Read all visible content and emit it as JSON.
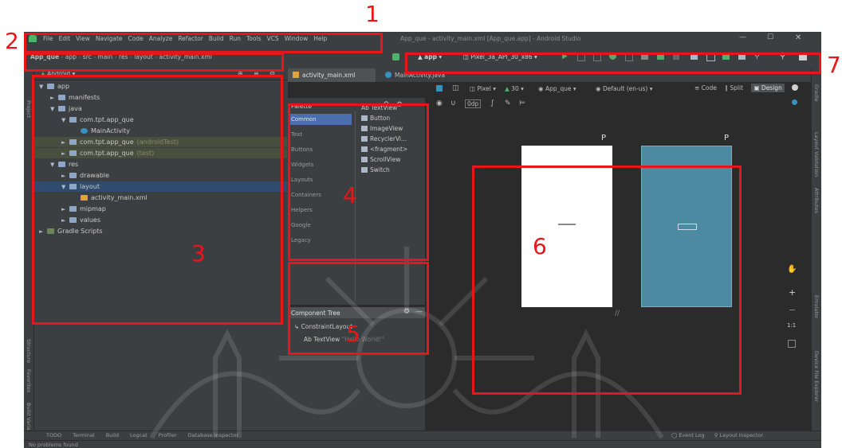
{
  "title_bar": {
    "menu": [
      "File",
      "Edit",
      "View",
      "Navigate",
      "Code",
      "Analyze",
      "Refactor",
      "Build",
      "Run",
      "Tools",
      "VCS",
      "Window",
      "Help"
    ],
    "title": "App_que - activity_main.xml [App_que.app] - Android Studio"
  },
  "breadcrumb": [
    "App_que",
    "app",
    "src",
    "main",
    "res",
    "layout",
    "activity_main.xml"
  ],
  "run_toolbar": {
    "config": "app",
    "device": "Pixel_3a_API_30_x86"
  },
  "project_panel": {
    "view_mode": "Android",
    "tree": [
      {
        "label": "app",
        "depth": 0,
        "open": true
      },
      {
        "label": "manifests",
        "depth": 1,
        "open": false
      },
      {
        "label": "java",
        "depth": 1,
        "open": true
      },
      {
        "label": "com.tpt.app_que",
        "depth": 2,
        "open": true
      },
      {
        "label": "MainActivity",
        "depth": 3,
        "open": false
      },
      {
        "label": "com.tpt.app_que",
        "depth": 2,
        "open": false,
        "note": "(androidTest)"
      },
      {
        "label": "com.tpt.app_que",
        "depth": 2,
        "open": false,
        "note": "(test)"
      },
      {
        "label": "res",
        "depth": 1,
        "open": true
      },
      {
        "label": "drawable",
        "depth": 2,
        "open": false
      },
      {
        "label": "layout",
        "depth": 2,
        "open": true
      },
      {
        "label": "activity_main.xml",
        "depth": 3,
        "open": false
      },
      {
        "label": "mipmap",
        "depth": 2,
        "open": false
      },
      {
        "label": "values",
        "depth": 2,
        "open": false
      },
      {
        "label": "Gradle Scripts",
        "depth": 0,
        "open": false
      }
    ]
  },
  "editor_tabs": [
    "activity_main.xml",
    "MainActivity.java"
  ],
  "view_modes": [
    "Code",
    "Split",
    "Design"
  ],
  "palette": {
    "title": "Palette",
    "categories": [
      "Common",
      "Text",
      "Buttons",
      "Widgets",
      "Layouts",
      "Containers",
      "Helpers",
      "Google",
      "Legacy"
    ],
    "items": [
      "Ab TextView",
      "Button",
      "ImageView",
      "RecyclerVi...",
      "<fragment>",
      "ScrollView",
      "Switch"
    ]
  },
  "design_toolbar": {
    "device": "Pixel",
    "api": "30",
    "theme": "App_que",
    "locale": "Default (en-us)",
    "margin": "0dp"
  },
  "component_tree": {
    "title": "Component Tree",
    "root": "ConstraintLayout",
    "child": "Ab TextView",
    "child_note": "\"Hello World!\""
  },
  "right_strip": [
    "Gradle",
    "Layout Validation",
    "Attributes",
    "Emulator",
    "Device File Explorer"
  ],
  "left_strip": [
    "Project",
    "Structure",
    "Favorites",
    "Build Variants"
  ],
  "bottom_tabs": [
    "TODO",
    "Terminal",
    "Build",
    "Logcat",
    "Profiler",
    "Database Inspector"
  ],
  "bottom_right_tabs": [
    "Event Log",
    "Layout Inspector"
  ],
  "status": {
    "message": "No problems found"
  },
  "annotations": [
    "1",
    "2",
    "3",
    "4",
    "5",
    "6",
    "7"
  ],
  "colors": {
    "annotation": "#e8161b",
    "ide_bg": "#3c3f41",
    "editor_bg": "#2b2b2b",
    "blueprint": "#4b8aa0"
  }
}
